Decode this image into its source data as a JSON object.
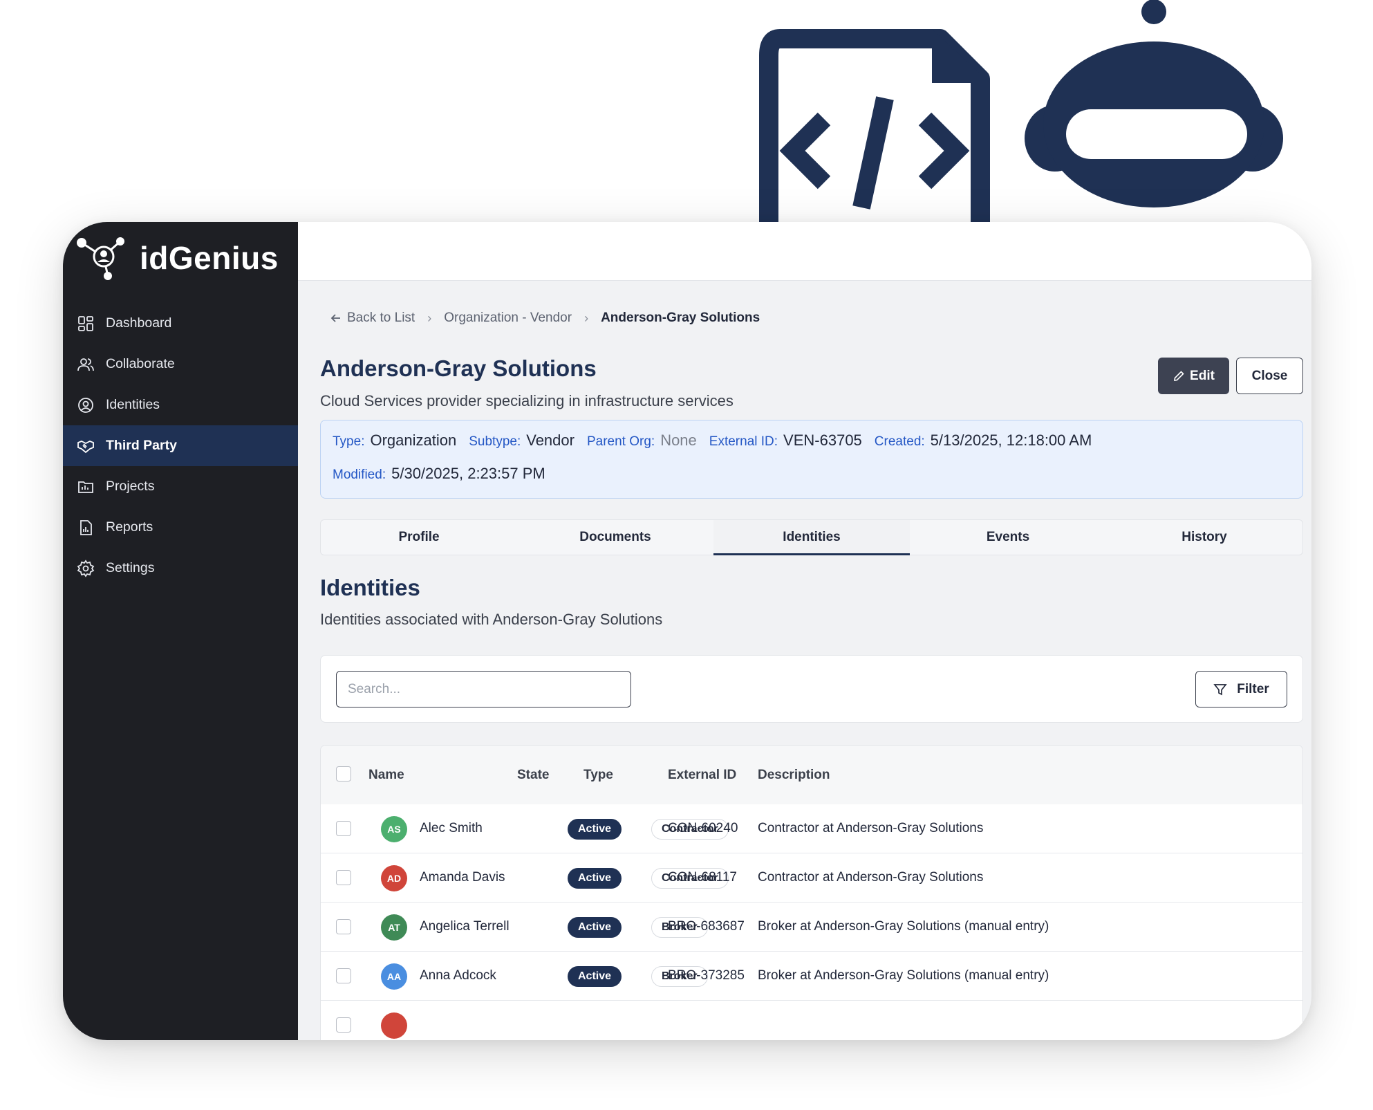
{
  "app": {
    "brand": "idGenius"
  },
  "sidebar": {
    "items": [
      {
        "label": "Dashboard",
        "icon": "dashboard-icon"
      },
      {
        "label": "Collaborate",
        "icon": "users-icon"
      },
      {
        "label": "Identities",
        "icon": "user-circle-icon"
      },
      {
        "label": "Third Party",
        "icon": "handshake-icon",
        "active": true
      },
      {
        "label": "Projects",
        "icon": "project-icon"
      },
      {
        "label": "Reports",
        "icon": "report-icon"
      },
      {
        "label": "Settings",
        "icon": "gear-icon"
      }
    ]
  },
  "breadcrumb": {
    "back": "Back to List",
    "parent": "Organization - Vendor",
    "current": "Anderson-Gray Solutions"
  },
  "header": {
    "title": "Anderson-Gray Solutions",
    "subtitle": "Cloud Services provider specializing in infrastructure services",
    "edit_label": "Edit",
    "close_label": "Close"
  },
  "meta": {
    "type_label": "Type:",
    "type": "Organization",
    "subtype_label": "Subtype:",
    "subtype": "Vendor",
    "parent_label": "Parent Org:",
    "parent": "None",
    "external_label": "External ID:",
    "external": "VEN-63705",
    "created_label": "Created:",
    "created": "5/13/2025, 12:18:00 AM",
    "modified_label": "Modified:",
    "modified": "5/30/2025, 2:23:57 PM"
  },
  "tabs": [
    {
      "label": "Profile"
    },
    {
      "label": "Documents"
    },
    {
      "label": "Identities",
      "active": true
    },
    {
      "label": "Events"
    },
    {
      "label": "History"
    }
  ],
  "section": {
    "title": "Identities",
    "subtitle": "Identities associated with Anderson-Gray Solutions"
  },
  "search": {
    "placeholder": "Search...",
    "value": ""
  },
  "filter_label": "Filter",
  "table": {
    "columns": [
      "Name",
      "State",
      "Type",
      "External ID",
      "Description"
    ],
    "rows": [
      {
        "initials": "AS",
        "avatar_color": "#4caf6e",
        "name": "Alec Smith",
        "state": "Active",
        "type": "Contractor",
        "external_id": "CON-60240",
        "description": "Contractor at Anderson-Gray Solutions"
      },
      {
        "initials": "AD",
        "avatar_color": "#d0453a",
        "name": "Amanda Davis",
        "state": "Active",
        "type": "Contractor",
        "external_id": "CON-68117",
        "description": "Contractor at Anderson-Gray Solutions"
      },
      {
        "initials": "AT",
        "avatar_color": "#3f8a56",
        "name": "Angelica Terrell",
        "state": "Active",
        "type": "Broker",
        "external_id": "BRO-683687",
        "description": "Broker at Anderson-Gray Solutions (manual entry)"
      },
      {
        "initials": "AA",
        "avatar_color": "#4a8ee0",
        "name": "Anna Adcock",
        "state": "Active",
        "type": "Broker",
        "external_id": "BRO-373285",
        "description": "Broker at Anderson-Gray Solutions (manual entry)"
      }
    ]
  },
  "colors": {
    "navy": "#1f3154",
    "sidebar_bg": "#1e1f24",
    "accent_blue": "#2457c5"
  }
}
